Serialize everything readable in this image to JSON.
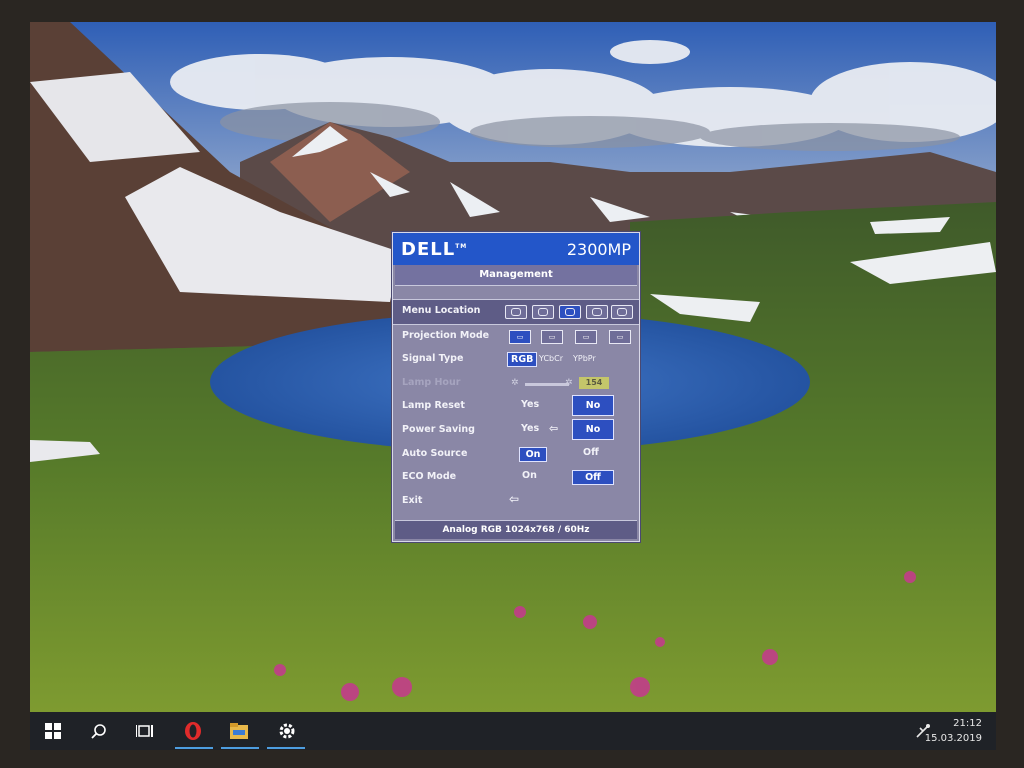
{
  "osd": {
    "brand": "DELL",
    "brand_tm": "TM",
    "model": "2300MP",
    "menu_title": "Management",
    "footer": "Analog RGB 1024x768 / 60Hz",
    "rows": {
      "menu_location": {
        "label": "Menu Location"
      },
      "projection_mode": {
        "label": "Projection Mode"
      },
      "signal_type": {
        "label": "Signal Type",
        "options": [
          "RGB",
          "YCbCr",
          "YPbPr"
        ],
        "selected": "RGB"
      },
      "lamp_hour": {
        "label": "Lamp Hour",
        "value": "154"
      },
      "lamp_reset": {
        "label": "Lamp Reset",
        "yes": "Yes",
        "no": "No",
        "selected": "No"
      },
      "power_saving": {
        "label": "Power Saving",
        "yes": "Yes",
        "no": "No",
        "selected": "No"
      },
      "auto_source": {
        "label": "Auto Source",
        "on": "On",
        "off": "Off",
        "selected": "On"
      },
      "eco_mode": {
        "label": "ECO Mode",
        "on": "On",
        "off": "Off",
        "selected": "Off"
      },
      "exit": {
        "label": "Exit"
      }
    }
  },
  "taskbar": {
    "time": "21:12",
    "date": "15.03.2019"
  },
  "colors": {
    "osd_header": "#2356c9",
    "osd_body": "#8a87a6",
    "osd_selected": "#2d4fc0",
    "taskbar": "#1f2227",
    "taskbar_active": "#4d9de0"
  },
  "icons": [
    "windows-logo-icon",
    "search-icon",
    "task-view-icon",
    "opera-icon",
    "file-explorer-icon",
    "settings-gear-icon",
    "network-icon"
  ]
}
